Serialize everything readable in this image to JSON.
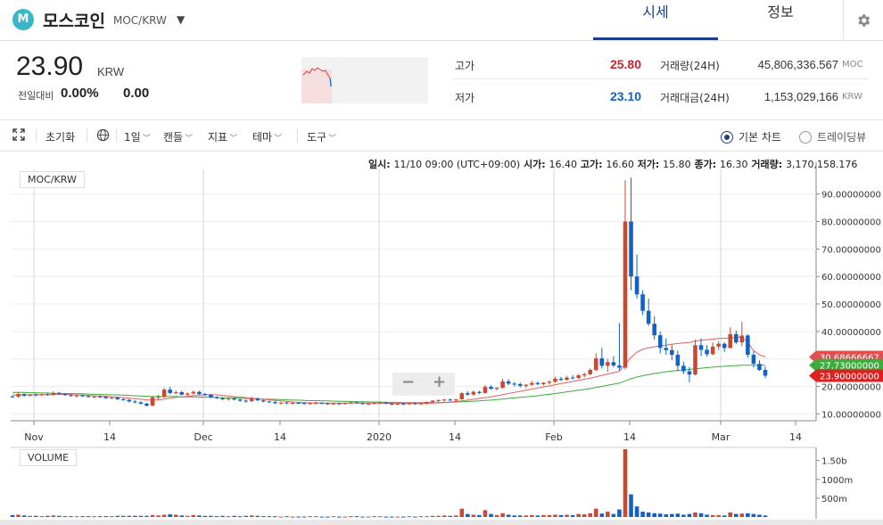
{
  "header": {
    "logo_letter": "M",
    "coin_name": "모스코인",
    "pair": "MOC/KRW",
    "tabs": [
      {
        "label": "시세"
      },
      {
        "label": "정보"
      }
    ]
  },
  "summary": {
    "price": "23.90",
    "price_unit": "KRW",
    "change_label": "전일대비",
    "change_rate": "0.00%",
    "change_amount": "0.00"
  },
  "stats": {
    "high_label": "고가",
    "high_value": "25.80",
    "low_label": "저가",
    "low_value": "23.10",
    "volume_label": "거래량(24H)",
    "volume_value": "45,806,336.567",
    "volume_unit": "MOC",
    "amount_label": "거래대금(24H)",
    "amount_value": "1,153,029,166",
    "amount_unit": "KRW"
  },
  "toolbar": {
    "reset": "초기화",
    "interval": "1일",
    "candle": "캔들",
    "indicator": "지표",
    "theme": "테마",
    "tools": "도구",
    "basic_chart": "기본 차트",
    "trading_view": "트레이딩뷰"
  },
  "info_line": {
    "date_label": "일시:",
    "date_value": "11/10 09:00 (UTC+09:00)",
    "open_label": "시가:",
    "open_value": "16.40",
    "high_label": "고가:",
    "high_value": "16.60",
    "low_label": "저가:",
    "low_value": "15.80",
    "close_label": "종가:",
    "close_value": "16.30",
    "volume_label": "거래량:",
    "volume_value": "3,170,158.176"
  },
  "colors": {
    "up": "#c84a31",
    "down": "#1261c4",
    "accent": "#1a3f8b",
    "ma_short": "#e06060",
    "ma_long": "#3aad3a"
  },
  "chart_data": {
    "type": "candlestick",
    "pair_label": "MOC/KRW",
    "volume_label": "VOLUME",
    "x_ticks": [
      "Nov",
      "14",
      "Dec",
      "14",
      "2020",
      "14",
      "Feb",
      "14",
      "Mar",
      "14"
    ],
    "y_ticks": [
      "10.00000000",
      "20.00000000",
      "30.00000000",
      "40.00000000",
      "50.00000000",
      "60.00000000",
      "70.00000000",
      "80.00000000",
      "90.00000000"
    ],
    "ylim": [
      7.5,
      99
    ],
    "volume_ticks": [
      "500m",
      "1000m",
      "1.50b"
    ],
    "price_tags": [
      {
        "value": "30.68666667",
        "y_value": 30.7,
        "color": "#e05050"
      },
      {
        "value": "27.73000000",
        "y_value": 27.7,
        "color": "#3aad3a"
      },
      {
        "value": "23.90000000",
        "y_value": 23.9,
        "color": "#e02020"
      }
    ],
    "candles": [
      [
        16.4,
        16.6,
        15.8,
        16.3,
        0.05
      ],
      [
        16.3,
        18,
        15.9,
        17.2,
        0.06
      ],
      [
        17.2,
        17.5,
        16.2,
        16.6,
        0.04
      ],
      [
        16.6,
        17.2,
        16.3,
        17,
        0.03
      ],
      [
        17,
        17.4,
        16.4,
        16.8,
        0.03
      ],
      [
        16.8,
        17.3,
        16.5,
        17.1,
        0.02
      ],
      [
        17.1,
        17.5,
        16.6,
        16.9,
        0.03
      ],
      [
        16.9,
        18.2,
        16.8,
        17.6,
        0.04
      ],
      [
        17.6,
        18,
        17,
        17.2,
        0.03
      ],
      [
        17.2,
        17.6,
        16.6,
        16.8,
        0.02
      ],
      [
        16.8,
        17.2,
        16.2,
        16.5,
        0.02
      ],
      [
        16.5,
        16.9,
        16,
        16.7,
        0.02
      ],
      [
        16.7,
        17,
        16.2,
        16.4,
        0.02
      ],
      [
        16.4,
        16.8,
        15.9,
        16.1,
        0.02
      ],
      [
        16.1,
        16.6,
        15.8,
        16.3,
        0.02
      ],
      [
        16.3,
        16.7,
        15.9,
        16.2,
        0.02
      ],
      [
        16.2,
        16.4,
        15.5,
        15.7,
        0.02
      ],
      [
        15.7,
        16.2,
        15.4,
        15.9,
        0.02
      ],
      [
        15.9,
        16.1,
        15,
        15.3,
        0.03
      ],
      [
        15.3,
        15.8,
        14.8,
        15.1,
        0.03
      ],
      [
        15.1,
        15.4,
        14.2,
        14.5,
        0.03
      ],
      [
        14.5,
        15,
        13.8,
        14.2,
        0.03
      ],
      [
        14.2,
        14.6,
        13.4,
        13.7,
        0.03
      ],
      [
        13.7,
        14,
        12.6,
        13,
        0.03
      ],
      [
        13,
        16.5,
        12.8,
        16,
        0.05
      ],
      [
        16,
        17,
        15.2,
        16.2,
        0.04
      ],
      [
        16.2,
        19.5,
        15.8,
        18.8,
        0.06
      ],
      [
        18.8,
        19.8,
        17.2,
        17.6,
        0.07
      ],
      [
        17.6,
        18.5,
        17,
        17.9,
        0.06
      ],
      [
        17.9,
        18.3,
        16.7,
        17,
        0.04
      ],
      [
        17,
        17.8,
        16.6,
        17.4,
        0.03
      ],
      [
        17.4,
        18.5,
        17,
        18,
        0.05
      ],
      [
        18,
        18.4,
        16.8,
        17.2,
        0.04
      ],
      [
        17.2,
        17.6,
        16.5,
        16.9,
        0.03
      ],
      [
        16.9,
        17.2,
        15.8,
        16,
        0.03
      ],
      [
        16,
        16.4,
        15.4,
        15.7,
        0.02
      ],
      [
        15.7,
        16.1,
        15,
        15.3,
        0.03
      ],
      [
        15.3,
        15.8,
        14.8,
        15.6,
        0.02
      ],
      [
        15.6,
        16,
        14.9,
        15.2,
        0.03
      ],
      [
        15.2,
        15.5,
        14.4,
        14.8,
        0.02
      ],
      [
        14.8,
        15.2,
        14.1,
        14.6,
        0.03
      ],
      [
        14.6,
        16.2,
        14.4,
        15.5,
        0.04
      ],
      [
        15.5,
        15.9,
        14.7,
        14.9,
        0.03
      ],
      [
        14.9,
        15.2,
        14.2,
        14.5,
        0.02
      ],
      [
        14.5,
        14.8,
        13.9,
        14.3,
        0.02
      ],
      [
        14.3,
        14.6,
        13.6,
        13.9,
        0.02
      ],
      [
        13.9,
        14.3,
        13.4,
        14.1,
        0.01
      ],
      [
        14.1,
        14.4,
        13.5,
        13.8,
        0.02
      ],
      [
        13.8,
        14.2,
        13.4,
        14,
        0.01
      ],
      [
        14,
        14.3,
        13.6,
        13.9,
        0.01
      ],
      [
        13.9,
        14.2,
        13.4,
        13.7,
        0.01
      ],
      [
        13.7,
        14.1,
        13.3,
        13.9,
        0.02
      ],
      [
        13.9,
        14.3,
        13.5,
        14,
        0.02
      ],
      [
        14,
        14.2,
        13.5,
        13.8,
        0.01
      ],
      [
        13.8,
        14.1,
        13.3,
        13.6,
        0.01
      ],
      [
        13.6,
        14,
        13.2,
        13.8,
        0.02
      ],
      [
        13.8,
        14.1,
        13.4,
        13.7,
        0.01
      ],
      [
        13.7,
        14.1,
        13.3,
        13.9,
        0.01
      ],
      [
        13.9,
        14.4,
        13.6,
        14.2,
        0.02
      ],
      [
        14.2,
        14.5,
        13.7,
        13.9,
        0.02
      ],
      [
        13.9,
        14.2,
        13.4,
        13.6,
        0.01
      ],
      [
        13.6,
        14,
        13.2,
        13.7,
        0.01
      ],
      [
        13.7,
        14.2,
        13.4,
        14,
        0.02
      ],
      [
        14,
        14.4,
        13.6,
        14.1,
        0.02
      ],
      [
        14.1,
        14.4,
        13.5,
        13.7,
        0.01
      ],
      [
        13.7,
        14,
        13.2,
        13.4,
        0.01
      ],
      [
        13.4,
        13.9,
        13.1,
        13.7,
        0.01
      ],
      [
        13.7,
        14,
        13.2,
        13.5,
        0.01
      ],
      [
        13.5,
        14,
        13.2,
        13.8,
        0.02
      ],
      [
        13.8,
        14.2,
        13.4,
        13.6,
        0.01
      ],
      [
        13.6,
        14,
        13.2,
        13.8,
        0.02
      ],
      [
        13.8,
        14.5,
        13.5,
        14.3,
        0.02
      ],
      [
        14.3,
        15,
        14,
        14.8,
        0.03
      ],
      [
        14.8,
        15.2,
        14.2,
        15,
        0.03
      ],
      [
        15,
        15.5,
        14.5,
        15.2,
        0.04
      ],
      [
        15.2,
        15.6,
        14.7,
        14.9,
        0.03
      ],
      [
        14.9,
        15.4,
        14.6,
        15.3,
        0.04
      ],
      [
        15.3,
        18,
        15.1,
        17.5,
        0.22
      ],
      [
        17.5,
        18.2,
        16.6,
        17,
        0.08
      ],
      [
        17,
        18.5,
        16.7,
        18,
        0.06
      ],
      [
        18,
        18.4,
        17.2,
        17.6,
        0.05
      ],
      [
        17.6,
        20.5,
        17.4,
        19.8,
        0.18
      ],
      [
        19.8,
        20.4,
        18.8,
        19.1,
        0.08
      ],
      [
        19.1,
        19.7,
        18.5,
        19.5,
        0.05
      ],
      [
        19.5,
        22.8,
        19.2,
        21.8,
        0.1
      ],
      [
        21.8,
        22.6,
        20.5,
        21,
        0.06
      ],
      [
        21,
        21.5,
        20,
        20.8,
        0.04
      ],
      [
        20.8,
        21.4,
        19.6,
        20.2,
        0.04
      ],
      [
        20.2,
        20.8,
        19.4,
        20.6,
        0.04
      ],
      [
        20.6,
        22,
        20.2,
        21.2,
        0.05
      ],
      [
        21.2,
        21.8,
        20.4,
        20.8,
        0.04
      ],
      [
        20.8,
        21.6,
        20.3,
        21.3,
        0.05
      ],
      [
        21.3,
        22.2,
        20.8,
        21.7,
        0.05
      ],
      [
        21.7,
        23.5,
        21.3,
        22.8,
        0.06
      ],
      [
        22.8,
        23.4,
        21.9,
        22.4,
        0.05
      ],
      [
        22.4,
        23.8,
        22.1,
        23.2,
        0.06
      ],
      [
        23.2,
        24,
        22.6,
        23,
        0.05
      ],
      [
        23,
        24.5,
        22.8,
        24,
        0.08
      ],
      [
        24,
        25,
        23.2,
        24.4,
        0.07
      ],
      [
        24.4,
        26.5,
        24,
        26,
        0.1
      ],
      [
        26,
        32,
        25.5,
        30.2,
        0.22
      ],
      [
        30.2,
        34,
        26.5,
        27.5,
        0.09
      ],
      [
        27.5,
        30,
        25.2,
        28.8,
        0.14
      ],
      [
        28.8,
        31,
        27,
        27.6,
        0.08
      ],
      [
        27.6,
        43,
        25.8,
        26.8,
        0.2
      ],
      [
        26.8,
        95,
        26.2,
        80,
        1.8
      ],
      [
        80,
        96,
        55,
        60,
        0.6
      ],
      [
        60,
        68,
        52,
        53.5,
        0.28
      ],
      [
        53.5,
        55,
        46,
        47.5,
        0.14
      ],
      [
        47.5,
        52,
        42,
        42.8,
        0.12
      ],
      [
        42.8,
        45.5,
        37,
        38.6,
        0.1
      ],
      [
        38.6,
        40,
        32,
        34,
        0.09
      ],
      [
        34,
        37.5,
        31.5,
        33.2,
        0.07
      ],
      [
        33.2,
        35,
        29.5,
        31.5,
        0.08
      ],
      [
        31.5,
        33,
        25.5,
        27.5,
        0.09
      ],
      [
        27.5,
        29,
        24.5,
        25.5,
        0.06
      ],
      [
        25.5,
        27,
        21.5,
        24.3,
        0.08
      ],
      [
        24.3,
        37,
        24,
        35,
        0.12
      ],
      [
        35,
        37.5,
        31,
        33.3,
        0.1
      ],
      [
        33.3,
        35,
        30.8,
        31.7,
        0.06
      ],
      [
        31.7,
        36,
        31.4,
        34.5,
        0.05
      ],
      [
        34.5,
        36.5,
        33.2,
        35.5,
        0.05
      ],
      [
        35.5,
        36,
        32.5,
        34,
        0.04
      ],
      [
        34,
        41.5,
        33.8,
        39,
        0.12
      ],
      [
        39,
        40.3,
        35.4,
        36,
        0.08
      ],
      [
        36,
        43.5,
        34.6,
        38.5,
        0.09
      ],
      [
        38.5,
        39,
        30.5,
        31.5,
        0.1
      ],
      [
        31.5,
        32.8,
        26.8,
        28.2,
        0.08
      ],
      [
        28.2,
        29.5,
        25.6,
        26,
        0.06
      ],
      [
        26,
        27.2,
        23,
        23.9,
        0.04
      ]
    ],
    "ma_short_line": [
      16.8,
      16.9,
      16.9,
      16.9,
      17,
      17,
      17,
      17,
      17.1,
      17.1,
      17,
      16.9,
      16.8,
      16.7,
      16.6,
      16.5,
      16.4,
      16.2,
      16.1,
      15.9,
      15.7,
      15.5,
      15.3,
      15.1,
      15,
      15.1,
      15.4,
      15.7,
      16,
      16.2,
      16.4,
      16.6,
      16.8,
      16.9,
      17,
      16.9,
      16.7,
      16.5,
      16.3,
      16.1,
      15.9,
      15.7,
      15.5,
      15.3,
      15.1,
      14.9,
      14.7,
      14.5,
      14.3,
      14.2,
      14.1,
      14,
      14,
      13.9,
      13.9,
      13.9,
      13.9,
      13.9,
      13.9,
      13.9,
      13.9,
      13.9,
      13.9,
      13.9,
      13.9,
      13.8,
      13.8,
      13.8,
      13.8,
      13.8,
      13.8,
      13.8,
      13.9,
      14,
      14.1,
      14.3,
      14.5,
      14.7,
      15,
      15.3,
      15.6,
      15.9,
      16.2,
      16.6,
      17,
      17.4,
      17.8,
      18.2,
      18.6,
      19,
      19.4,
      19.8,
      20.2,
      20.6,
      21,
      21.4,
      21.8,
      22.2,
      22.6,
      23,
      23.5,
      24,
      24.5,
      25,
      25.5,
      28,
      30.5,
      32.5,
      33.5,
      34,
      34.4,
      34.8,
      35,
      35.3,
      35.6,
      35.8,
      36,
      36.5,
      36.8,
      37,
      37.2,
      37.4,
      37.5,
      37.6,
      37.8,
      38,
      36,
      33,
      31.5,
      30.7
    ],
    "ma_long_line": [
      17.8,
      17.8,
      17.8,
      17.7,
      17.7,
      17.6,
      17.6,
      17.5,
      17.5,
      17.4,
      17.4,
      17.3,
      17.3,
      17.2,
      17.1,
      17.1,
      17,
      16.9,
      16.9,
      16.8,
      16.7,
      16.6,
      16.5,
      16.4,
      16.3,
      16.3,
      16.3,
      16.3,
      16.3,
      16.2,
      16.2,
      16.2,
      16.1,
      16.1,
      16,
      16,
      15.9,
      15.9,
      15.8,
      15.7,
      15.6,
      15.6,
      15.5,
      15.4,
      15.3,
      15.3,
      15.2,
      15.1,
      15,
      15,
      14.9,
      14.8,
      14.8,
      14.7,
      14.7,
      14.6,
      14.6,
      14.5,
      14.5,
      14.4,
      14.4,
      14.3,
      14.3,
      14.3,
      14.2,
      14.2,
      14.2,
      14.1,
      14.1,
      14.1,
      14.1,
      14.1,
      14.1,
      14.1,
      14.2,
      14.2,
      14.3,
      14.4,
      14.5,
      14.6,
      14.7,
      14.9,
      15,
      15.2,
      15.4,
      15.6,
      15.8,
      16,
      16.2,
      16.4,
      16.6,
      16.9,
      17.1,
      17.4,
      17.7,
      18,
      18.3,
      18.6,
      18.9,
      19.2,
      19.6,
      20,
      20.4,
      20.8,
      21.2,
      22,
      22.8,
      23.4,
      23.9,
      24.3,
      24.7,
      25,
      25.3,
      25.6,
      25.8,
      26,
      26.2,
      26.4,
      26.6,
      26.8,
      27,
      27.2,
      27.3,
      27.5,
      27.6,
      27.7,
      27.7,
      27.7,
      27.7,
      27.7
    ]
  }
}
